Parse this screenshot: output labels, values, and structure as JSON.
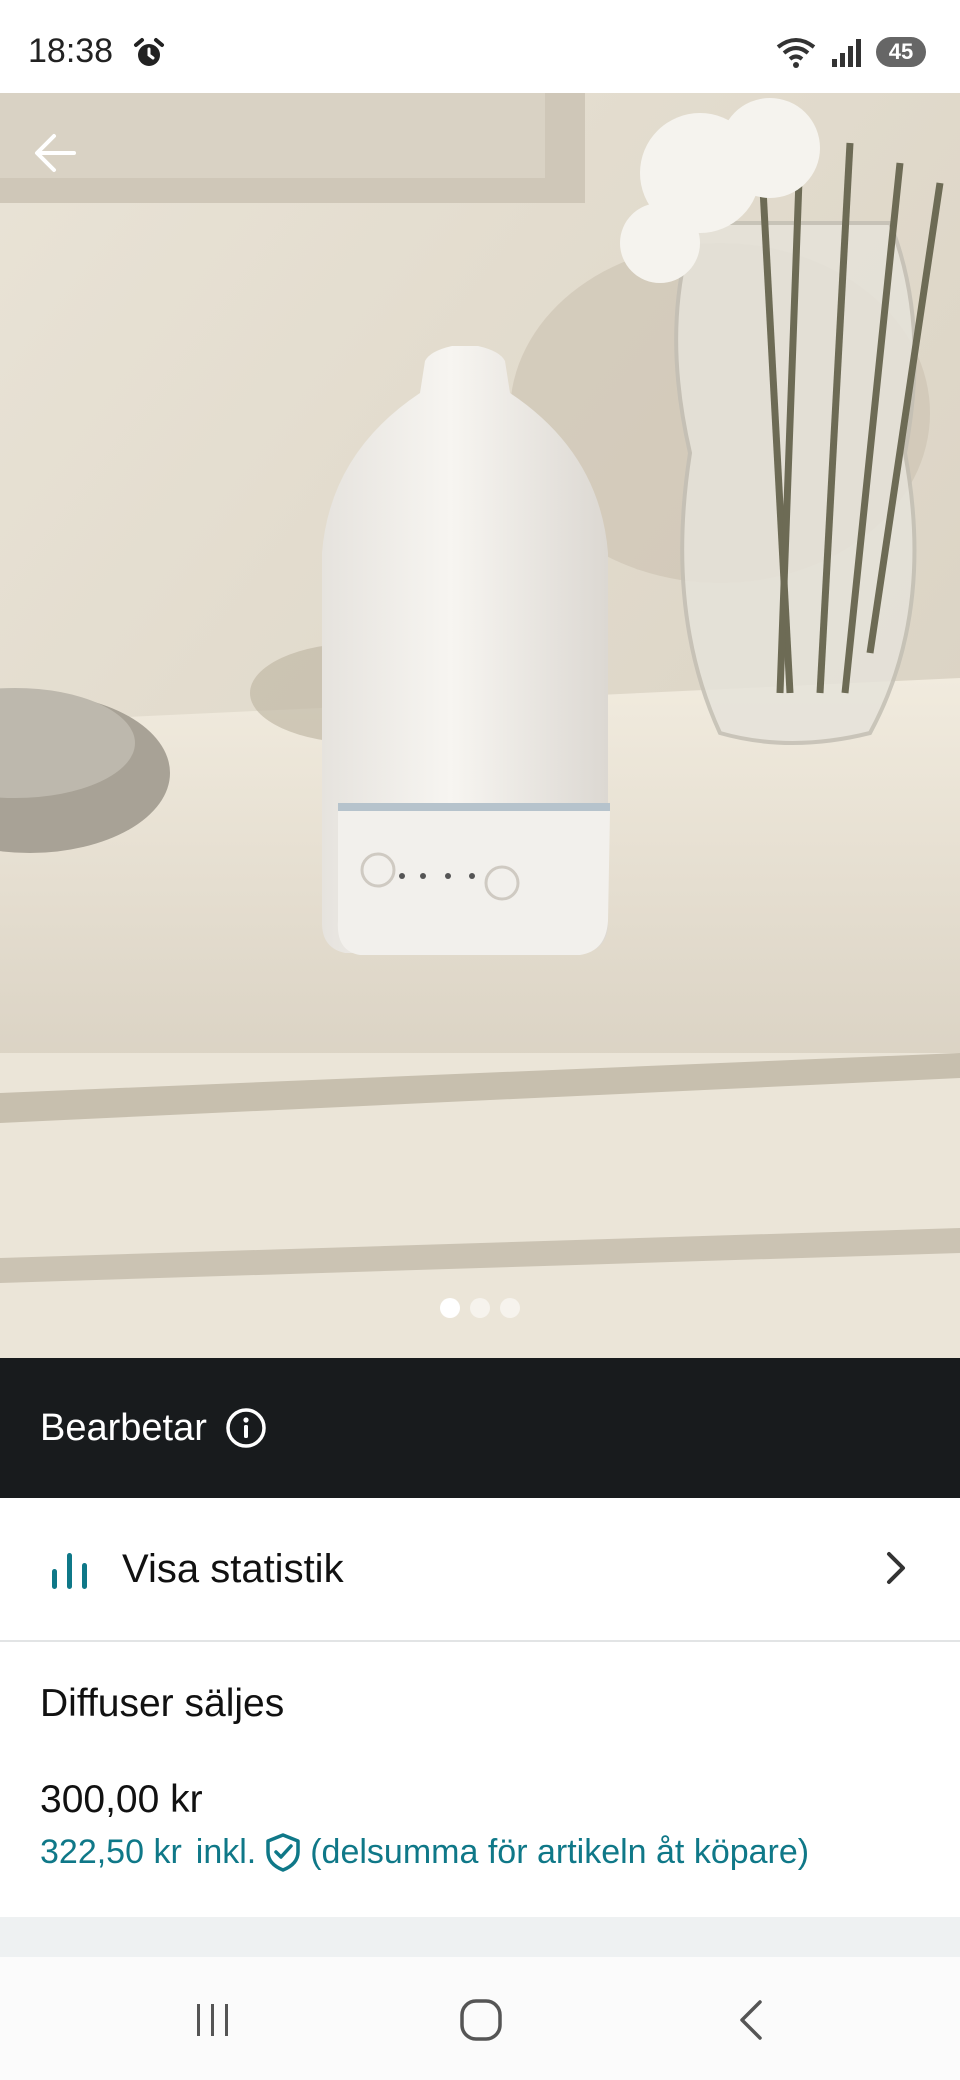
{
  "status_bar": {
    "time": "18:38",
    "battery": "45"
  },
  "listing": {
    "photo_count": 3,
    "active_photo_index": 0,
    "status_label": "Bearbetar",
    "stats_label": "Visa statistik",
    "title": "Diffuser säljes",
    "price": "300,00 kr",
    "buyer_price": "322,50 kr",
    "buyer_price_incl": "inkl.",
    "buyer_price_note": "(delsumma för artikeln åt köpare)"
  },
  "colors": {
    "accent_teal": "#0f7888",
    "status_strip_bg": "#181b1d",
    "divider": "#e2e4e5"
  },
  "icons": {
    "back": "arrow-left-icon",
    "info": "info-circle-icon",
    "stats": "bar-chart-icon",
    "chevron": "chevron-right-icon",
    "buyer_protection": "shield-check-icon",
    "alarm": "alarm-clock-icon",
    "nav_recents": "recents-icon",
    "nav_home": "home-icon",
    "nav_back": "nav-back-icon"
  }
}
